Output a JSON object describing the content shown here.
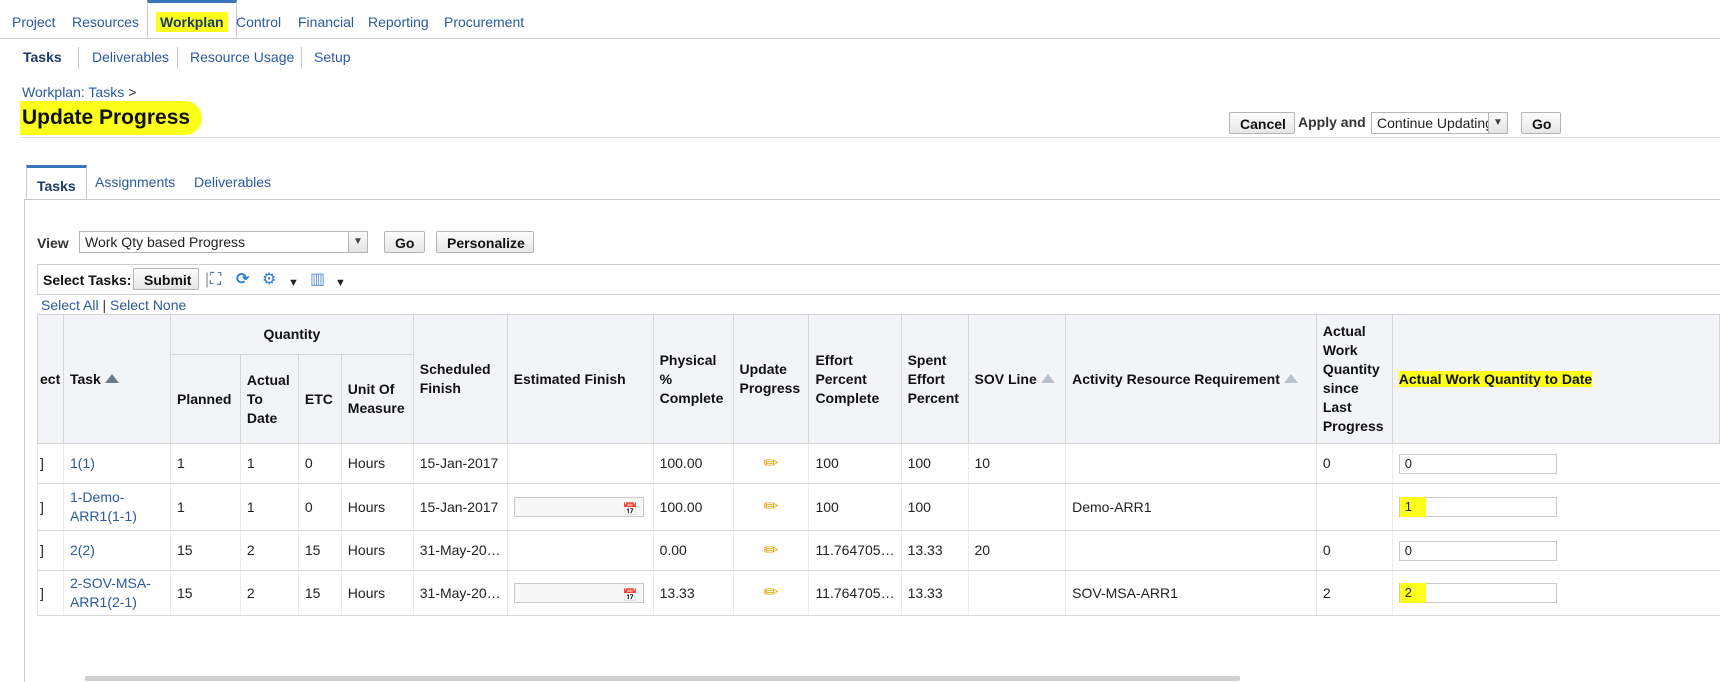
{
  "topnav": [
    "Project",
    "Resources",
    "Workplan",
    "Control",
    "Financial",
    "Reporting",
    "Procurement"
  ],
  "subnav": [
    "Tasks",
    "Deliverables",
    "Resource Usage",
    "Setup"
  ],
  "breadcrumb": {
    "link": "Workplan: Tasks",
    "sep": ">"
  },
  "page_title": "Update Progress",
  "actions": {
    "cancel": "Cancel",
    "apply_and": "Apply and",
    "continue_select": "Continue Updating",
    "go": "Go"
  },
  "content_tabs": [
    "Tasks",
    "Assignments",
    "Deliverables"
  ],
  "view": {
    "label": "View",
    "value": "Work Qty based Progress",
    "go": "Go",
    "personalize": "Personalize"
  },
  "toolbar": {
    "label": "Select Tasks:",
    "submit": "Submit"
  },
  "select": {
    "all": "Select All",
    "sep": "|",
    "none": "Select None"
  },
  "table": {
    "group_quantity": "Quantity",
    "headers": {
      "select": "ect",
      "task": "Task",
      "planned": "Planned",
      "actual_to_date": "Actual To Date",
      "etc": "ETC",
      "uom": "Unit Of Measure",
      "scheduled_finish": "Scheduled Finish",
      "estimated_finish": "Estimated Finish",
      "physical": "Physical % Complete",
      "update_progress": "Update Progress",
      "effort_percent": "Effort Percent Complete",
      "spent_effort": "Spent Effort Percent",
      "sov_line": "SOV Line",
      "activity_resource": "Activity Resource Requirement",
      "actual_since_last": "Actual Work Quantity since Last Progress",
      "actual_work_qty": "Actual Work Quantity to Date"
    },
    "rows": [
      {
        "sel": "]",
        "task": "1(1)",
        "planned": "1",
        "actual": "1",
        "etc": "0",
        "uom": "Hours",
        "sched": "15-Jan-2017",
        "est_input": false,
        "physical": "100.00",
        "effort": "100",
        "spent": "100",
        "sov": "10",
        "arr": "",
        "since": "0",
        "qty": "0",
        "qty_hl": false
      },
      {
        "sel": "]",
        "task": "1-Demo-ARR1(1-1)",
        "planned": "1",
        "actual": "1",
        "etc": "0",
        "uom": "Hours",
        "sched": "15-Jan-2017",
        "est_input": true,
        "physical": "100.00",
        "effort": "100",
        "spent": "100",
        "sov": "",
        "arr": "Demo-ARR1",
        "since": "",
        "qty": "1",
        "qty_hl": true
      },
      {
        "sel": "]",
        "task": "2(2)",
        "planned": "15",
        "actual": "2",
        "etc": "15",
        "uom": "Hours",
        "sched": "31-May-20…",
        "est_input": false,
        "physical": "0.00",
        "effort": "11.764705…",
        "spent": "13.33",
        "sov": "20",
        "arr": "",
        "since": "0",
        "qty": "0",
        "qty_hl": false
      },
      {
        "sel": "]",
        "task": "2-SOV-MSA-ARR1(2-1)",
        "planned": "15",
        "actual": "2",
        "etc": "15",
        "uom": "Hours",
        "sched": "31-May-20…",
        "est_input": true,
        "physical": "13.33",
        "effort": "11.764705…",
        "spent": "13.33",
        "sov": "",
        "arr": "SOV-MSA-ARR1",
        "since": "2",
        "qty": "2",
        "qty_hl": true
      }
    ]
  }
}
